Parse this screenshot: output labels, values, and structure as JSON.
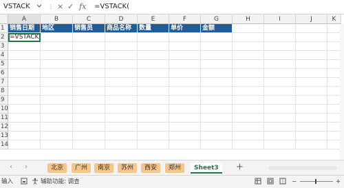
{
  "formula_bar": {
    "name_box": "VSTACK",
    "formula": "=VSTACK(",
    "fx_label": "fx",
    "cancel_symbol": "×",
    "enter_symbol": "✓"
  },
  "columns": [
    "A",
    "B",
    "C",
    "D",
    "E",
    "F",
    "G",
    "H",
    "I",
    "J",
    "K"
  ],
  "rows": [
    "1",
    "2",
    "3",
    "4",
    "5",
    "6",
    "7",
    "8",
    "9",
    "10",
    "11",
    "12",
    "13",
    "14"
  ],
  "header_row": [
    "销售日期",
    "地区",
    "销售员",
    "商品名称",
    "数量",
    "单价",
    "金额"
  ],
  "active_cell": {
    "ref": "A2",
    "value": "=VSTACK("
  },
  "colors": {
    "header_fill": "#1f5c99",
    "header_text": "#ffffff",
    "accent": "#217346",
    "tab_fill": "#f5c68a"
  },
  "sheet_tabs": [
    "北京",
    "广州",
    "南京",
    "苏州",
    "西安",
    "郑州",
    "Sheet3"
  ],
  "active_sheet": "Sheet3",
  "add_sheet_label": "+",
  "status_bar": {
    "mode": "输入",
    "accessibility": "辅助功能: 调查"
  }
}
